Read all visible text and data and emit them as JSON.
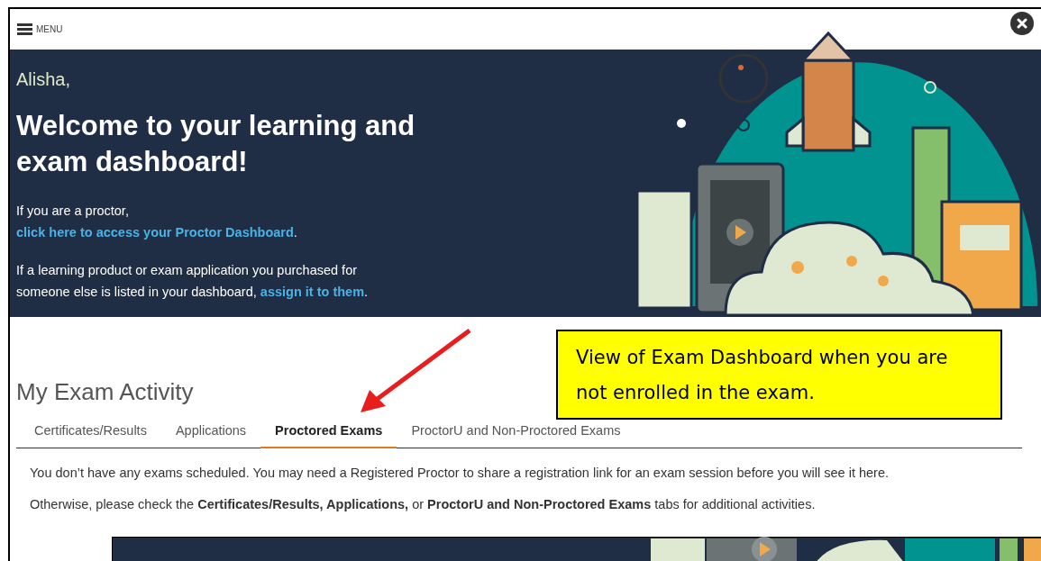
{
  "menu": {
    "label": "MENU"
  },
  "hero": {
    "greeting": "Alisha,",
    "title": "Welcome to your learning and exam dashboard!",
    "proctor": {
      "text": "If you are a proctor, ",
      "link": "click here to access your Proctor Dashboard",
      "end": "."
    },
    "assign": {
      "text": "If a learning product or exam application you purchased for someone else is listed in your dashboard, ",
      "link": "assign it to them",
      "end": "."
    }
  },
  "activity": {
    "title": "My Exam Activity",
    "tabs": [
      {
        "label": "Certificates/Results",
        "selected": false
      },
      {
        "label": "Applications",
        "selected": false
      },
      {
        "label": "Proctored Exams",
        "selected": true
      },
      {
        "label": "ProctorU and Non-Proctored Exams",
        "selected": false
      }
    ],
    "messages": [
      "You don’t have any exams scheduled. You may need a Registered Proctor to share a registration link for an exam session before you will see it here.",
      "Otherwise, please check the **Certificates/Results, Applications,** or **ProctorU and Non-Proctored Exams** tabs for additional activities."
    ]
  },
  "callout": {
    "text": "View of Exam Dashboard when you are not enrolled in the exam."
  }
}
